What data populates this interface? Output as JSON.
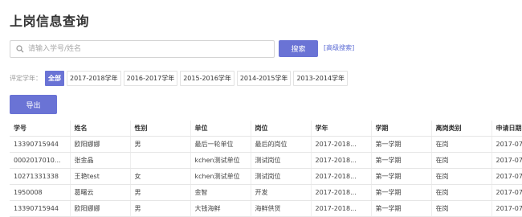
{
  "page": {
    "title": "上岗信息查询"
  },
  "search": {
    "placeholder": "请输入学号/姓名",
    "button": "搜索",
    "advanced": "[高级搜索]"
  },
  "filters": {
    "label": "评定学年：",
    "options": [
      "全部",
      "2017-2018学年",
      "2016-2017学年",
      "2015-2016学年",
      "2014-2015学年",
      "2013-2014学年"
    ],
    "selected": "全部"
  },
  "toolbar": {
    "export": "导出"
  },
  "table": {
    "columns": [
      "学号",
      "姓名",
      "性别",
      "单位",
      "岗位",
      "学年",
      "学期",
      "离岗类别",
      "申请日期"
    ],
    "rows": [
      [
        "13390715944",
        "欧阳娜娜",
        "男",
        "最后一轮单位",
        "最后的岗位",
        "2017-2018...",
        "第一学期",
        "在岗",
        "2017-07-"
      ],
      [
        "0002017010...",
        "张金晶",
        "",
        "kchen测试单位",
        "测试岗位",
        "2017-2018...",
        "第一学期",
        "在岗",
        "2017-07-"
      ],
      [
        "10271331338",
        "王艳test",
        "女",
        "kchen测试单位",
        "测试岗位",
        "2017-2018...",
        "第一学期",
        "在岗",
        "2017-07-"
      ],
      [
        "1950008",
        "葛曙云",
        "男",
        "金智",
        "开发",
        "2017-2018...",
        "第一学期",
        "在岗",
        "2017-07-"
      ],
      [
        "13390715944",
        "欧阳娜娜",
        "男",
        "大钱海鲜",
        "海鲜供货",
        "2017-2018...",
        "第一学期",
        "在岗",
        "2017-07-"
      ]
    ]
  },
  "colors": {
    "accent": "#6a73d5",
    "link": "#5a6ad4"
  },
  "icons": {
    "search": "search-icon"
  }
}
